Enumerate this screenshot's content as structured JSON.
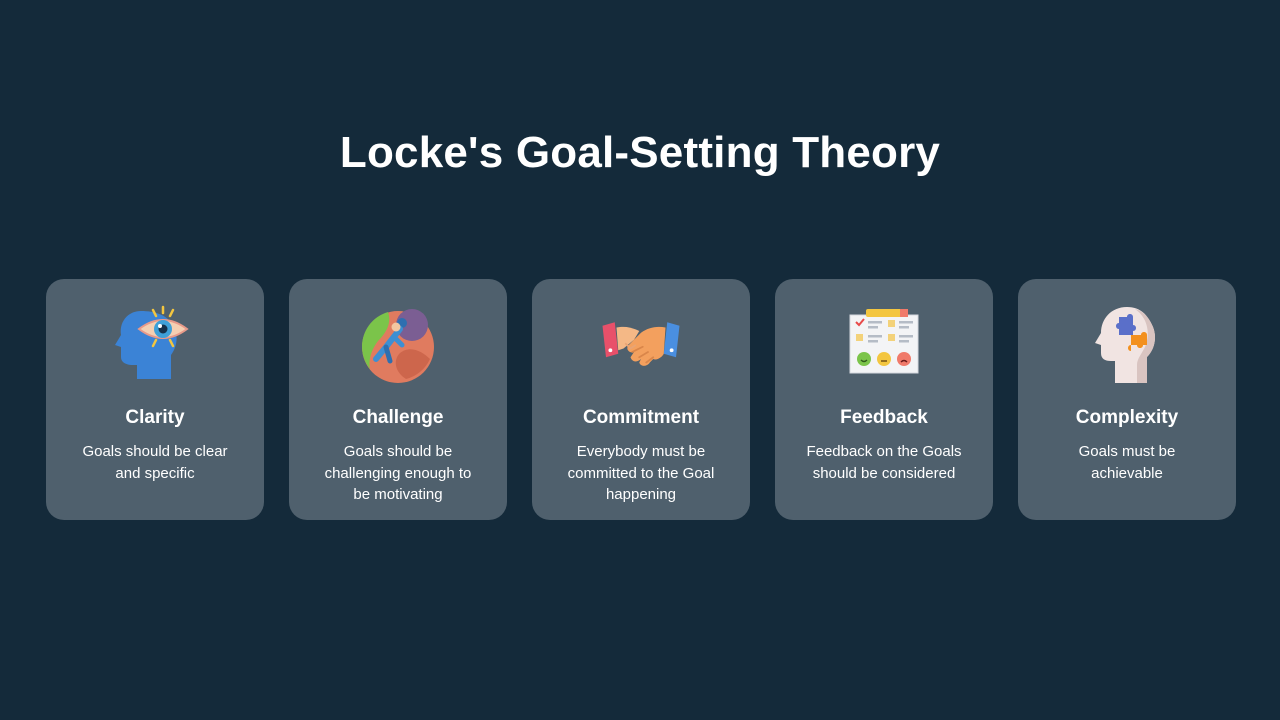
{
  "slide": {
    "title": "Locke's Goal-Setting Theory"
  },
  "cards": [
    {
      "icon": "eye-head-icon",
      "title": "Clarity",
      "description": "Goals should be clear and specific"
    },
    {
      "icon": "climbing-person-icon",
      "title": "Challenge",
      "description": "Goals should be challenging enough to be motivating"
    },
    {
      "icon": "handshake-icon",
      "title": "Commitment",
      "description": "Everybody must be committed to the Goal happening"
    },
    {
      "icon": "feedback-board-icon",
      "title": "Feedback",
      "description": "Feedback on the Goals should be considered"
    },
    {
      "icon": "puzzle-head-icon",
      "title": "Complexity",
      "description": "Goals must be achievable"
    }
  ],
  "colors": {
    "background": "#142a3a",
    "card": "#4f606d",
    "text": "#ffffff"
  }
}
